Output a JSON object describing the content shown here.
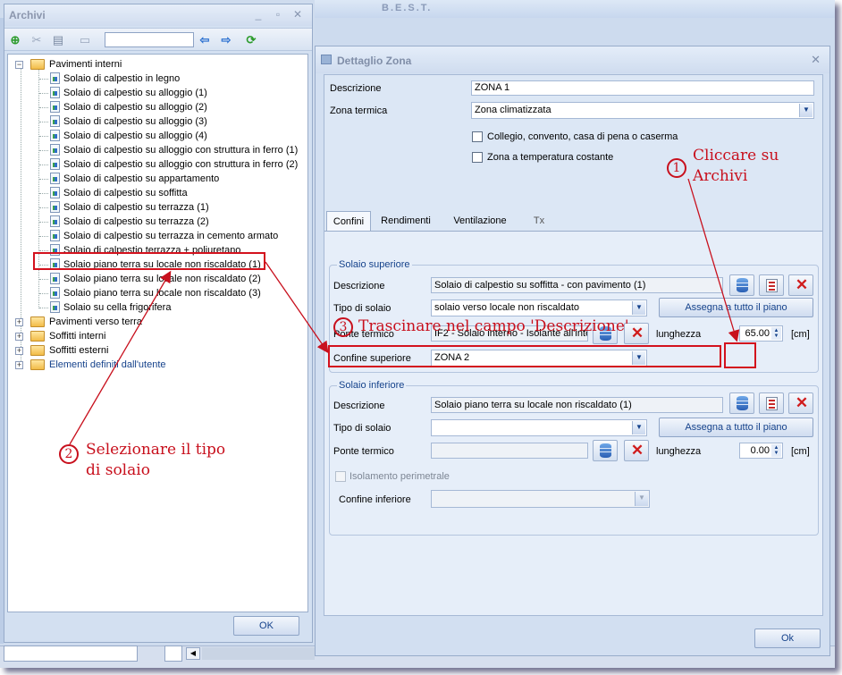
{
  "app": {
    "title": "B.E.S.T."
  },
  "archivi": {
    "title": "Archivi",
    "search_value": "",
    "ok_label": "OK",
    "tree": {
      "root_open": "Pavimenti interni",
      "children": [
        "Solaio di calpestio in legno",
        "Solaio di calpestio su alloggio (1)",
        "Solaio di calpestio su alloggio (2)",
        "Solaio di calpestio su alloggio (3)",
        "Solaio di calpestio su alloggio (4)",
        "Solaio di calpestio su alloggio con struttura in ferro (1)",
        "Solaio di calpestio su alloggio con struttura in ferro (2)",
        "Solaio di calpestio su appartamento",
        "Solaio di calpestio su soffitta",
        "Solaio di calpestio su terrazza (1)",
        "Solaio di calpestio su terrazza (2)",
        "Solaio di calpestio su terrazza in cemento armato",
        "Solaio di calpestio terrazza + poliuretano",
        "Solaio piano terra su locale non riscaldato (1)",
        "Solaio piano terra su locale non riscaldato (2)",
        "Solaio piano terra su locale non riscaldato (3)",
        "Solaio su cella frigorifera"
      ],
      "other_roots": [
        "Pavimenti verso terra",
        "Soffitti interni",
        "Soffitti esterni",
        "Elementi definiti dall'utente"
      ]
    }
  },
  "dettaglio": {
    "title": "Dettaglio Zona",
    "descrizione_label": "Descrizione",
    "descrizione_value": "ZONA 1",
    "zona_termica_label": "Zona termica",
    "zona_termica_value": "Zona climatizzata",
    "check1_label": "Collegio, convento, casa di pena o caserma",
    "check2_label": "Zona a temperatura costante",
    "tabs": [
      "Confini",
      "Rendimenti",
      "Ventilazione",
      "Tx"
    ],
    "superiore": {
      "title": "Solaio superiore",
      "descrizione_label": "Descrizione",
      "descrizione_value": "Solaio di calpestio su soffitta - con pavimento (1)",
      "tipo_label": "Tipo di solaio",
      "tipo_value": "solaio verso locale non riscaldato",
      "assegna_label": "Assegna a tutto il piano",
      "ponte_label": "Ponte termico",
      "ponte_value": "IF2 - Solaio interno - Isolante all'inte",
      "lunghezza_label": "lunghezza",
      "lunghezza_value": "65.00",
      "unit": "[cm]",
      "confine_label": "Confine superiore",
      "confine_value": "ZONA 2"
    },
    "inferiore": {
      "title": "Solaio inferiore",
      "descrizione_label": "Descrizione",
      "descrizione_value": "Solaio piano terra su locale non riscaldato (1)",
      "tipo_label": "Tipo di solaio",
      "tipo_value": "",
      "assegna_label": "Assegna a tutto il piano",
      "ponte_label": "Ponte termico",
      "ponte_value": "",
      "lunghezza_label": "lunghezza",
      "lunghezza_value": "0.00",
      "unit": "[cm]",
      "isolamento_label": "Isolamento perimetrale",
      "confine_label": "Confine inferiore",
      "confine_value": ""
    },
    "ok_label": "Ok"
  },
  "annotations": {
    "a1_num": "1",
    "a1_line1": "Cliccare su",
    "a1_line2": "Archivi",
    "a2_num": "2",
    "a2_line1": "Selezionare il tipo",
    "a2_line2": "di solaio",
    "a3_num": "3",
    "a3_text": "Trascinare nel campo 'Descrizione'"
  },
  "colors": {
    "annotation_red": "#c8101d",
    "accent_blue": "#15428b"
  }
}
